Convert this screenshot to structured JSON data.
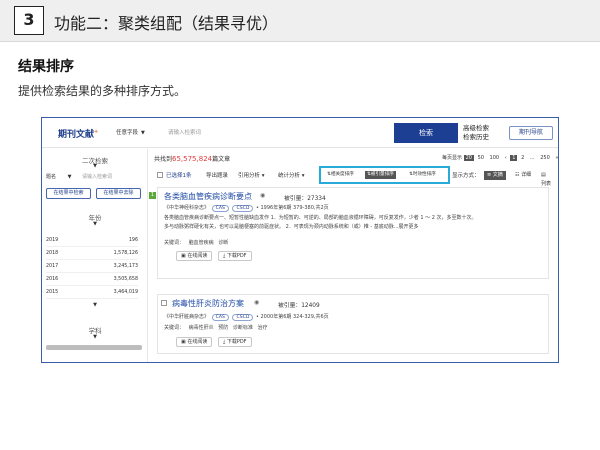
{
  "header": {
    "number": "3",
    "title": "功能二：聚类组配（结果寻优）"
  },
  "section": {
    "heading": "结果排序",
    "description": "提供检索结果的多种排序方式。"
  },
  "screenshot": {
    "brand": "期刊文献",
    "brand_sup": "+",
    "search": {
      "field": "任意字段",
      "placeholder": "请输入检索词",
      "button": "检索",
      "advanced": "高级检索",
      "history": "检索历史",
      "nav_button": "期刊导航"
    },
    "left_panel": {
      "secondary_search": "二次检索",
      "field_select": "题名",
      "input_placeholder": "请输入检索词",
      "btn_in_results": "在结果中检索",
      "btn_exclude": "在结果中去除",
      "year_title": "年份",
      "years": [
        {
          "year": "2019",
          "count": "196"
        },
        {
          "year": "2018",
          "count": "1,578,126"
        },
        {
          "year": "2017",
          "count": "3,245,173"
        },
        {
          "year": "2016",
          "count": "3,505,658"
        },
        {
          "year": "2015",
          "count": "3,464,019"
        }
      ],
      "subject_title": "学科"
    },
    "main": {
      "found_prefix": "共找到",
      "found_count": "65,575,824",
      "found_suffix": "篇文章",
      "per_page_label": "每页显示",
      "per_page_options": [
        "20",
        "50",
        "100"
      ],
      "pages": [
        "1",
        "2",
        "...",
        "250",
        "»"
      ],
      "selected": "已选择1条",
      "export": "导出题录",
      "citation_analysis": "引用分析",
      "stats": "统计分析",
      "sort_options": [
        "相关度排序",
        "被引量排序",
        "时效性排序"
      ],
      "display_label": "显示方式：",
      "views": [
        "文摘",
        "详细",
        "列表"
      ]
    },
    "results": [
      {
        "tag": "1",
        "title": "各类脑血管疾病诊断要点",
        "citations": "被引量：27334",
        "journal": "《中华神经科杂志》",
        "badges": [
          "CAS",
          "CSCD"
        ],
        "issue": "• 1996年第6期 379-380,共2页",
        "abstract": [
          "各类脑血管疾病诊断要点一、短暂性脑缺血发作 1．为短暂的、可逆的、局部的脑血液循环障碍，可反复发作，少者 1 ～ 2 次，多至数十次。",
          "多与动脉粥样硬化有关，也可以是脑梗塞的前驱症状。 2．可表现为颈内动脉系统和（或）椎 - 基底动脉...展开更多"
        ],
        "keywords_label": "关键词：",
        "keywords": [
          "脑血管疾病",
          "诊断"
        ],
        "read": "在线阅读",
        "download": "下载PDF"
      },
      {
        "tag": "",
        "title": "病毒性肝炎防治方案",
        "citations": "被引量：12409",
        "journal": "《中华肝脏病杂志》",
        "badges": [
          "CAS",
          "CSCD"
        ],
        "issue": "• 2000年第6期 324-329,共6页",
        "abstract": [],
        "keywords_label": "关键词：",
        "keywords": [
          "病毒性肝炎",
          "预防",
          "诊断标准",
          "治疗"
        ],
        "read": "在线阅读",
        "download": "下载PDF"
      }
    ]
  }
}
